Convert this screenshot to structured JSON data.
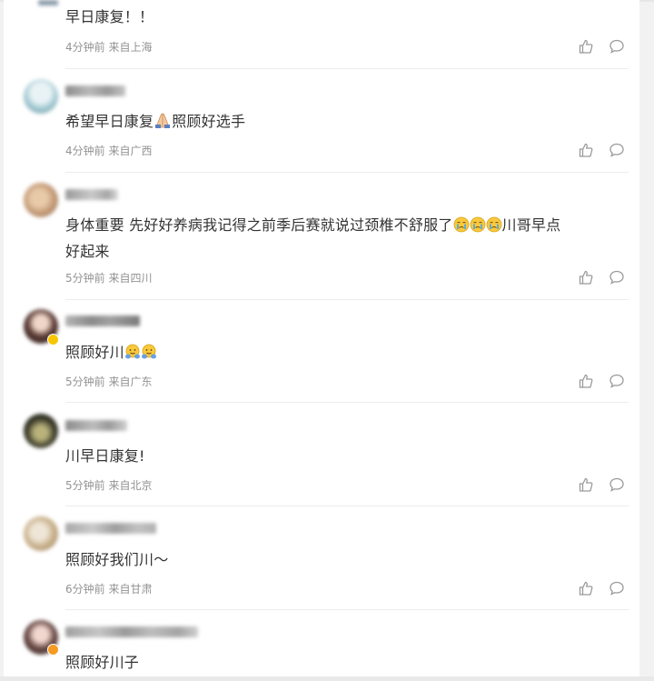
{
  "comments": [
    {
      "text": "早日康复！！",
      "time": "4分钟前",
      "location": "来自上海"
    },
    {
      "text": "希望早日康复",
      "text2": "照顾好选手",
      "time": "4分钟前",
      "location": "来自广西",
      "emoji": "pray"
    },
    {
      "text": "身体重要 先好好养病我记得之前季后赛就说过颈椎不舒服了",
      "text2": "川哥早点",
      "text3": "好起来",
      "time": "5分钟前",
      "location": "来自四川",
      "emoji": "cry"
    },
    {
      "text": "照顾好川",
      "time": "5分钟前",
      "location": "来自广东",
      "emoji": "hug"
    },
    {
      "text": "川早日康复!",
      "time": "5分钟前",
      "location": "来自北京"
    },
    {
      "text": "照顾好我们川～",
      "time": "6分钟前",
      "location": "来自甘肃"
    },
    {
      "text": "照顾好川子"
    }
  ],
  "icons": {
    "like": "thumb-up-icon",
    "reply": "comment-bubble-icon",
    "pray": "pray-icon",
    "cry": "crying-icon",
    "hug": "hug-icon"
  },
  "colors": {
    "text": "#333333",
    "meta": "#939393",
    "divider": "#ededed",
    "verified_orange": "#f59b22",
    "verified_gold": "#f7c600"
  }
}
